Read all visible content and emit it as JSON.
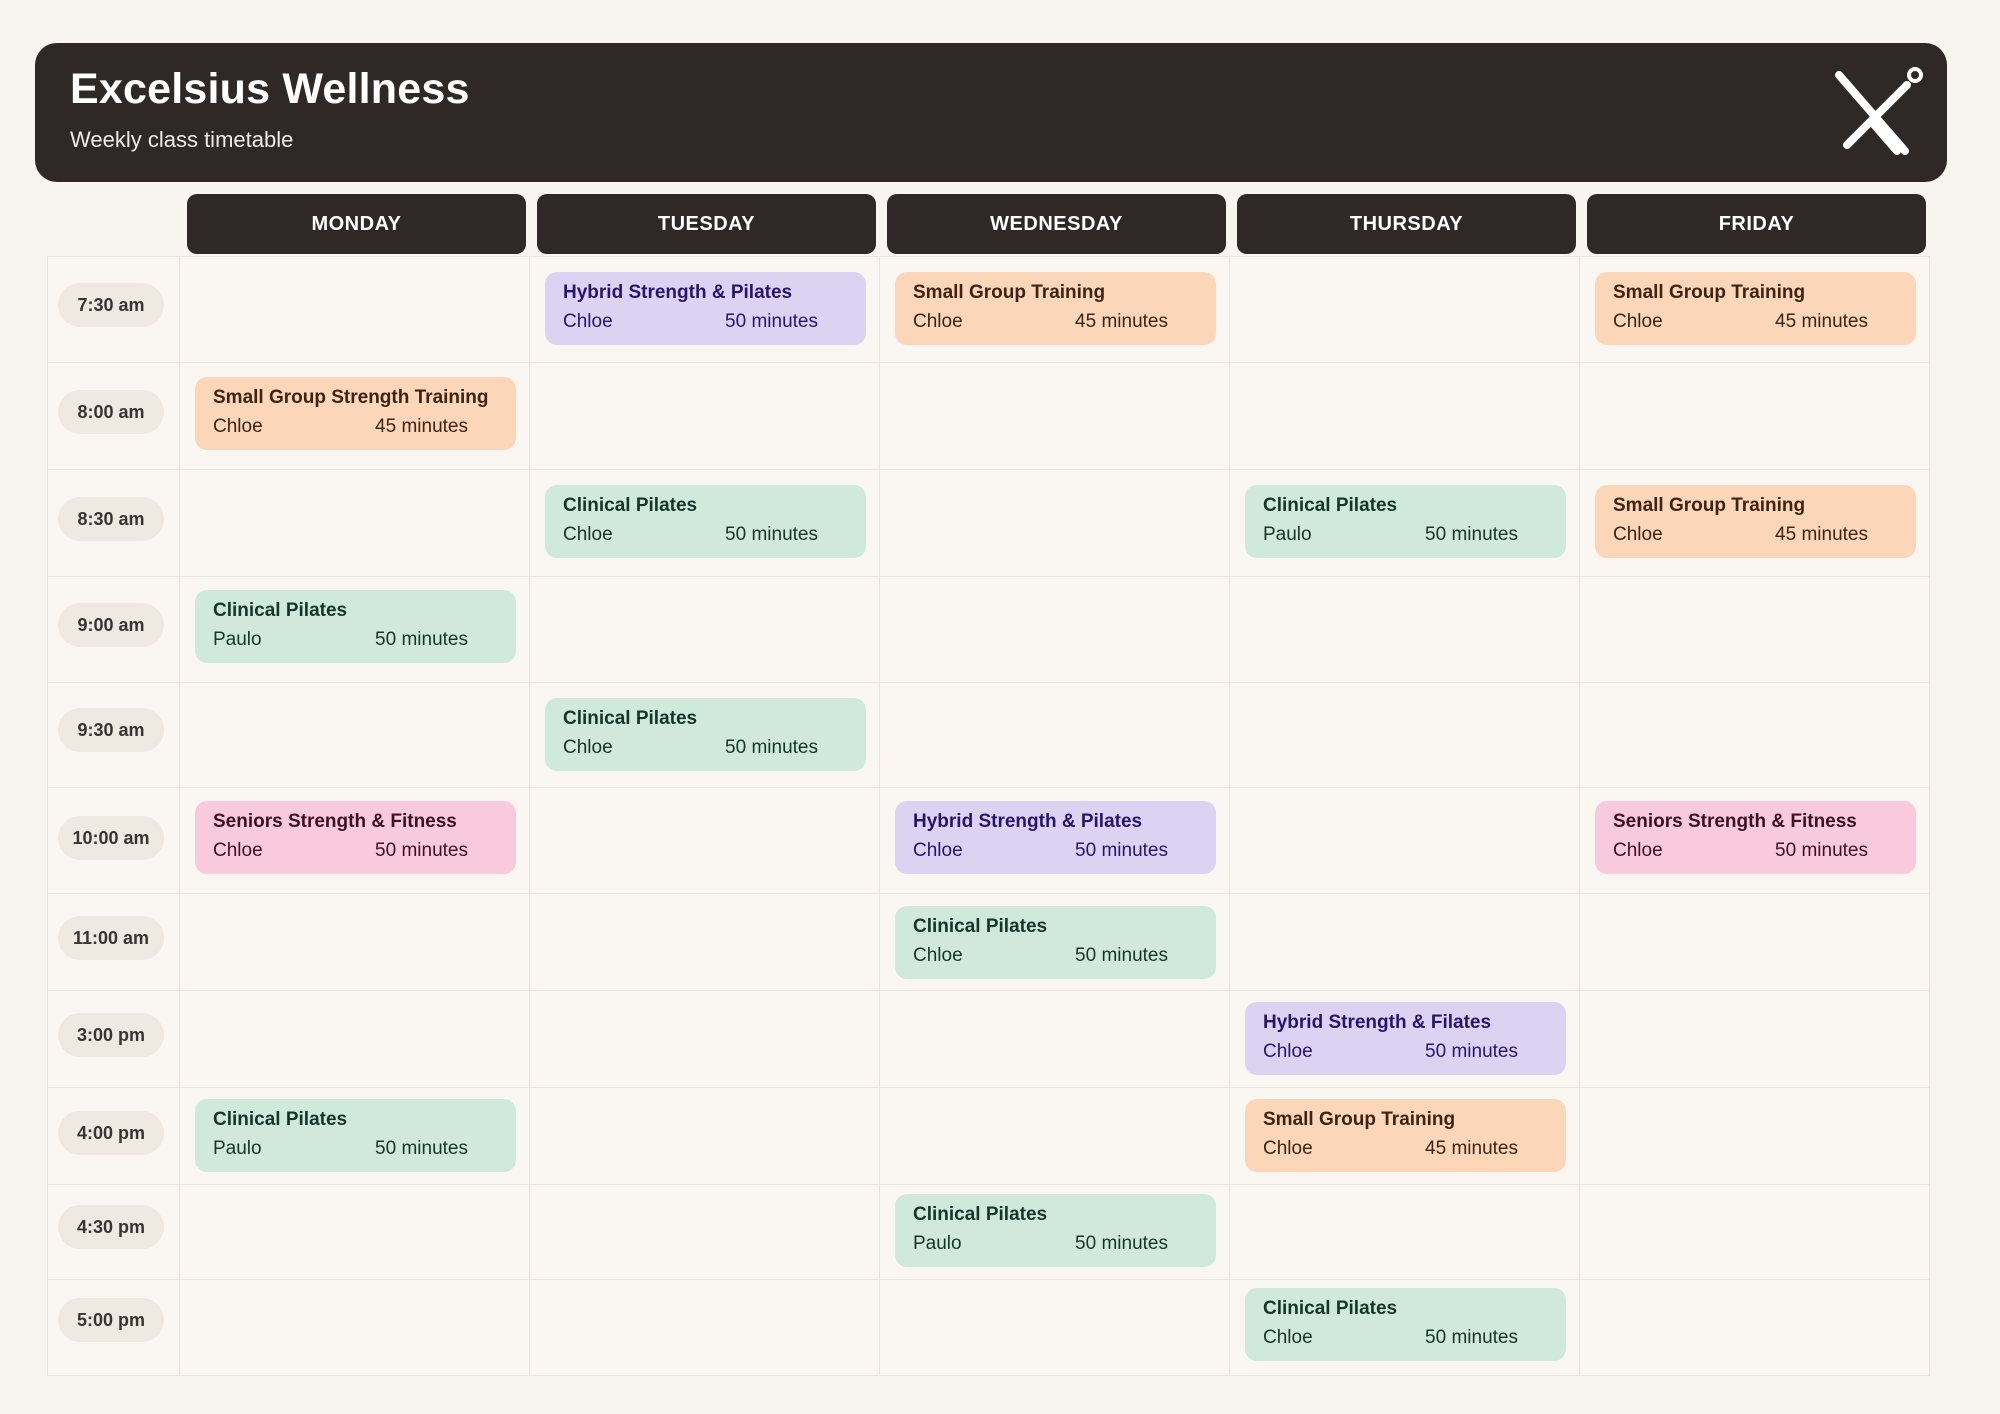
{
  "header": {
    "title": "Excelsius Wellness",
    "subtitle": "Weekly class timetable",
    "logo_icon": "x-figure-logo-icon"
  },
  "days": [
    "MONDAY",
    "TUESDAY",
    "WEDNESDAY",
    "THURSDAY",
    "FRIDAY"
  ],
  "times": [
    "7:30 am",
    "8:00 am",
    "8:30 am",
    "9:00 am",
    "9:30 am",
    "10:00 am",
    "11:00 am",
    "3:00 pm",
    "4:00 pm",
    "4:30 pm",
    "5:00 pm"
  ],
  "colors": {
    "header_bg": "#2e2926",
    "green": "#cfeadd",
    "orange": "#fcd6b8",
    "purple": "#dcd3f3",
    "pink": "#f9cadb"
  },
  "classes": [
    {
      "day": 1,
      "slot": 0,
      "name": "Hybrid Strength & Pilates",
      "instructor": "Chloe",
      "duration": "50 minutes",
      "color": "purple"
    },
    {
      "day": 2,
      "slot": 0,
      "name": "Small Group Training",
      "instructor": "Chloe",
      "duration": "45 minutes",
      "color": "orange"
    },
    {
      "day": 4,
      "slot": 0,
      "name": "Small Group Training",
      "instructor": "Chloe",
      "duration": "45 minutes",
      "color": "orange"
    },
    {
      "day": 0,
      "slot": 1,
      "name": "Small Group Strength Training",
      "instructor": "Chloe",
      "duration": "45 minutes",
      "color": "orange"
    },
    {
      "day": 1,
      "slot": 2,
      "name": "Clinical Pilates",
      "instructor": "Chloe",
      "duration": "50 minutes",
      "color": "green"
    },
    {
      "day": 3,
      "slot": 2,
      "name": "Clinical Pilates",
      "instructor": "Paulo",
      "duration": "50 minutes",
      "color": "green"
    },
    {
      "day": 4,
      "slot": 2,
      "name": "Small Group Training",
      "instructor": "Chloe",
      "duration": "45 minutes",
      "color": "orange"
    },
    {
      "day": 0,
      "slot": 3,
      "name": "Clinical Pilates",
      "instructor": "Paulo",
      "duration": "50 minutes",
      "color": "green"
    },
    {
      "day": 1,
      "slot": 4,
      "name": "Clinical Pilates",
      "instructor": "Chloe",
      "duration": "50 minutes",
      "color": "green"
    },
    {
      "day": 0,
      "slot": 5,
      "name": "Seniors Strength & Fitness",
      "instructor": "Chloe",
      "duration": "50 minutes",
      "color": "pink"
    },
    {
      "day": 2,
      "slot": 5,
      "name": "Hybrid Strength & Pilates",
      "instructor": "Chloe",
      "duration": "50 minutes",
      "color": "purple"
    },
    {
      "day": 4,
      "slot": 5,
      "name": "Seniors Strength & Fitness",
      "instructor": "Chloe",
      "duration": "50 minutes",
      "color": "pink"
    },
    {
      "day": 2,
      "slot": 6,
      "name": "Clinical Pilates",
      "instructor": "Chloe",
      "duration": "50 minutes",
      "color": "green"
    },
    {
      "day": 3,
      "slot": 7,
      "name": "Hybrid Strength & Filates",
      "instructor": "Chloe",
      "duration": "50 minutes",
      "color": "purple"
    },
    {
      "day": 0,
      "slot": 8,
      "name": "Clinical Pilates",
      "instructor": "Paulo",
      "duration": "50 minutes",
      "color": "green"
    },
    {
      "day": 3,
      "slot": 8,
      "name": "Small Group Training",
      "instructor": "Chloe",
      "duration": "45 minutes",
      "color": "orange"
    },
    {
      "day": 2,
      "slot": 9,
      "name": "Clinical Pilates",
      "instructor": "Paulo",
      "duration": "50 minutes",
      "color": "green"
    },
    {
      "day": 3,
      "slot": 10,
      "name": "Clinical Pilates",
      "instructor": "Chloe",
      "duration": "50 minutes",
      "color": "green"
    }
  ]
}
